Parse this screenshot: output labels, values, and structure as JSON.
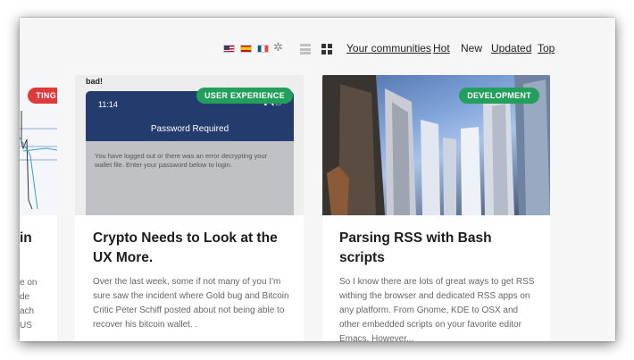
{
  "header": {
    "flags": [
      "us-flag-icon",
      "spain-flag-icon",
      "france-flag-icon"
    ],
    "settings_icon": "gear-icon",
    "view_icons": [
      "list-view-icon",
      "grid-view-icon"
    ],
    "nav": {
      "your_communities": "Your communities",
      "hot": "Hot",
      "new": "New",
      "updated": "Updated",
      "top": "Top"
    }
  },
  "cards": [
    {
      "badge": "TING",
      "badge_color": "#e2393a",
      "title_fragment": "in",
      "excerpt_fragments": [
        "e on",
        "de",
        "ach",
        "US"
      ]
    },
    {
      "badge": "USER EXPERIENCE",
      "badge_color": "#239f5c",
      "title": "Crypto Needs to Look at the UX More.",
      "excerpt": "Over the last week, some if not many of you I'm sure saw the incident where Gold bug and Bitcoin Critic Peter Schiff posted about not being able to recover his bitcoin wallet. .",
      "thumbnail": {
        "top_text": "bad!",
        "time": "11:14",
        "header": "Password Required",
        "message": "You have logged out or there was an error decrypting your wallet file. Enter your password below to login."
      }
    },
    {
      "badge": "DEVELOPMENT",
      "badge_color": "#239f5c",
      "title": "Parsing RSS with Bash scripts",
      "excerpt": "So I know there are lots of great ways to get RSS withing the browser and dedicated RSS apps on any platform. From Gnome, KDE to OSX and other embedded scripts on your favorite editor Emacs. However..."
    }
  ]
}
